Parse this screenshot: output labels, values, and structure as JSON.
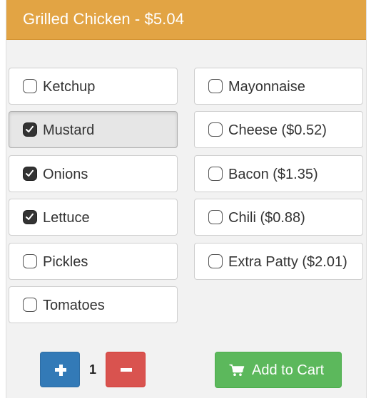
{
  "header": {
    "title": "Grilled Chicken - $5.04",
    "color": "#e2a444"
  },
  "options_left": [
    {
      "label": "Ketchup",
      "checked": false
    },
    {
      "label": "Mustard",
      "checked": true
    },
    {
      "label": "Onions",
      "checked": true
    },
    {
      "label": "Lettuce",
      "checked": true
    },
    {
      "label": "Pickles",
      "checked": false
    },
    {
      "label": "Tomatoes",
      "checked": false
    }
  ],
  "options_right": [
    {
      "label": "Mayonnaise",
      "checked": false
    },
    {
      "label": "Cheese ($0.52)",
      "checked": false
    },
    {
      "label": "Bacon ($1.35)",
      "checked": false
    },
    {
      "label": "Chili ($0.88)",
      "checked": false
    },
    {
      "label": "Extra Patty ($2.01)",
      "checked": false
    }
  ],
  "quantity": {
    "value": "1",
    "plus_icon": "plus-icon",
    "minus_icon": "minus-icon",
    "plus_color": "#337ab7",
    "minus_color": "#d9534f"
  },
  "cart": {
    "label": "Add to Cart",
    "icon": "shopping-cart-icon",
    "color": "#5cb85c"
  }
}
